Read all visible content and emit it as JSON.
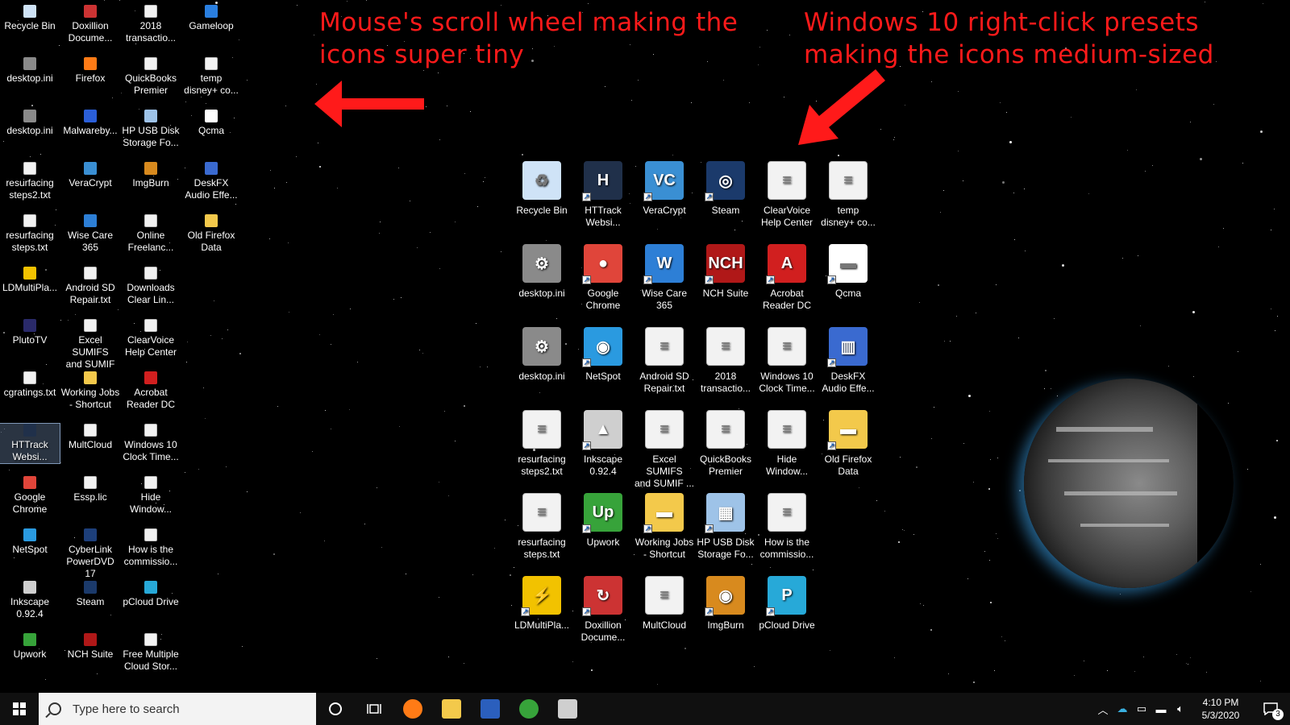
{
  "annotations": {
    "left": [
      "Mouse's scroll wheel making the",
      "icons super tiny"
    ],
    "right": [
      "Windows 10 right-click presets",
      "making the icons medium-sized"
    ],
    "color": "#ff1a1a"
  },
  "small_icons": [
    {
      "label": [
        "Recycle Bin"
      ],
      "icon": "recycle-bin-icon",
      "color": "#cfe3f7"
    },
    {
      "label": [
        "desktop.ini"
      ],
      "icon": "settings-file-icon",
      "color": "#8a8a8a"
    },
    {
      "label": [
        "desktop.ini"
      ],
      "icon": "settings-file-icon",
      "color": "#8a8a8a"
    },
    {
      "label": [
        "resurfacing",
        "steps2.txt"
      ],
      "icon": "text-file-icon",
      "color": "#f2f2f2"
    },
    {
      "label": [
        "resurfacing",
        "steps.txt"
      ],
      "icon": "text-file-icon",
      "color": "#f2f2f2"
    },
    {
      "label": [
        "LDMultiPla..."
      ],
      "icon": "ldmultiplayer-icon",
      "color": "#f2c200"
    },
    {
      "label": [
        "PlutoTV"
      ],
      "icon": "plutotv-icon",
      "color": "#2a2a6a"
    },
    {
      "label": [
        "cgratings.txt"
      ],
      "icon": "text-file-icon",
      "color": "#f2f2f2"
    },
    {
      "label": [
        "HTTrack",
        "Websi..."
      ],
      "icon": "httrack-icon",
      "color": "#20304a",
      "selected": true
    },
    {
      "label": [
        "Google",
        "Chrome"
      ],
      "icon": "chrome-icon",
      "color": "#e0453a"
    },
    {
      "label": [
        "NetSpot"
      ],
      "icon": "netspot-icon",
      "color": "#2a9ae0"
    },
    {
      "label": [
        "Inkscape",
        "0.92.4"
      ],
      "icon": "inkscape-icon",
      "color": "#cfcfcf"
    },
    {
      "label": [
        "Upwork"
      ],
      "icon": "upwork-icon",
      "color": "#37a33a"
    },
    {
      "label": [
        "Doxillion",
        "Docume..."
      ],
      "icon": "doxillion-icon",
      "color": "#c33"
    },
    {
      "label": [
        "Firefox"
      ],
      "icon": "firefox-icon",
      "color": "#ff7b16"
    },
    {
      "label": [
        "Malwareby..."
      ],
      "icon": "malwarebytes-icon",
      "color": "#2b5fd9"
    },
    {
      "label": [
        "VeraCrypt"
      ],
      "icon": "veracrypt-icon",
      "color": "#3a8fd3"
    },
    {
      "label": [
        "Wise Care",
        "365"
      ],
      "icon": "wisecare-icon",
      "color": "#2d7fd6"
    },
    {
      "label": [
        "Android SD",
        "Repair.txt"
      ],
      "icon": "text-file-icon",
      "color": "#f2f2f2"
    },
    {
      "label": [
        "Excel SUMIFS",
        "and SUMIF ..."
      ],
      "icon": "text-file-icon",
      "color": "#f2f2f2"
    },
    {
      "label": [
        "Working Jobs",
        "- Shortcut"
      ],
      "icon": "folder-icon",
      "color": "#f3c94b"
    },
    {
      "label": [
        "MultCloud"
      ],
      "icon": "text-file-icon",
      "color": "#f2f2f2"
    },
    {
      "label": [
        "Essp.lic"
      ],
      "icon": "text-file-icon",
      "color": "#f2f2f2"
    },
    {
      "label": [
        "CyberLink",
        "PowerDVD 17"
      ],
      "icon": "powerdvd-icon",
      "color": "#1d3f7a"
    },
    {
      "label": [
        "Steam"
      ],
      "icon": "steam-icon",
      "color": "#1b3a6b"
    },
    {
      "label": [
        "NCH Suite"
      ],
      "icon": "nch-icon",
      "color": "#b01818"
    },
    {
      "label": [
        "2018",
        "transactio..."
      ],
      "icon": "text-file-icon",
      "color": "#f2f2f2"
    },
    {
      "label": [
        "QuickBooks",
        "Premier"
      ],
      "icon": "text-file-icon",
      "color": "#f2f2f2"
    },
    {
      "label": [
        "HP USB Disk",
        "Storage Fo..."
      ],
      "icon": "hp-usb-icon",
      "color": "#9ec3e8"
    },
    {
      "label": [
        "ImgBurn"
      ],
      "icon": "imgburn-icon",
      "color": "#d88a1e"
    },
    {
      "label": [
        "Online",
        "Freelanc..."
      ],
      "icon": "text-file-icon",
      "color": "#f2f2f2"
    },
    {
      "label": [
        "Downloads",
        "Clear Lin..."
      ],
      "icon": "text-file-icon",
      "color": "#f2f2f2"
    },
    {
      "label": [
        "ClearVoice",
        "Help Center"
      ],
      "icon": "text-file-icon",
      "color": "#f2f2f2"
    },
    {
      "label": [
        "Acrobat",
        "Reader DC"
      ],
      "icon": "acrobat-icon",
      "color": "#d11f1f"
    },
    {
      "label": [
        "Windows 10",
        "Clock Time..."
      ],
      "icon": "text-file-icon",
      "color": "#f2f2f2"
    },
    {
      "label": [
        "Hide",
        "Window..."
      ],
      "icon": "text-file-icon",
      "color": "#f2f2f2"
    },
    {
      "label": [
        "How is the",
        "commissio..."
      ],
      "icon": "text-file-icon",
      "color": "#f2f2f2"
    },
    {
      "label": [
        "pCloud Drive"
      ],
      "icon": "pcloud-icon",
      "color": "#27a9d8"
    },
    {
      "label": [
        "Free Multiple",
        "Cloud Stor..."
      ],
      "icon": "text-file-icon",
      "color": "#f2f2f2"
    },
    {
      "label": [
        "Gameloop"
      ],
      "icon": "gameloop-icon",
      "color": "#2a7fe0"
    },
    {
      "label": [
        "temp",
        "disney+ co..."
      ],
      "icon": "text-file-icon",
      "color": "#f2f2f2"
    },
    {
      "label": [
        "Qcma"
      ],
      "icon": "qcma-icon",
      "color": "#ffffff"
    },
    {
      "label": [
        "DeskFX",
        "Audio Effe..."
      ],
      "icon": "deskfx-icon",
      "color": "#3a6ad0"
    },
    {
      "label": [
        "Old Firefox",
        "Data"
      ],
      "icon": "folder-icon",
      "color": "#f3c94b"
    }
  ],
  "medium_icons": [
    {
      "label": [
        "Recycle Bin"
      ],
      "icon": "recycle-bin-icon",
      "color": "#cfe3f7",
      "glyph": "♻"
    },
    {
      "label": [
        "desktop.ini"
      ],
      "icon": "settings-file-icon",
      "color": "#8a8a8a",
      "glyph": "⚙"
    },
    {
      "label": [
        "desktop.ini"
      ],
      "icon": "settings-file-icon",
      "color": "#8a8a8a",
      "glyph": "⚙"
    },
    {
      "label": [
        "resurfacing",
        "steps2.txt"
      ],
      "icon": "text-file-icon",
      "color": "#f2f2f2",
      "glyph": "≡"
    },
    {
      "label": [
        "resurfacing",
        "steps.txt"
      ],
      "icon": "text-file-icon",
      "color": "#f2f2f2",
      "glyph": "≡"
    },
    {
      "label": [
        "LDMultiPla..."
      ],
      "icon": "ldmultiplayer-icon",
      "color": "#f2c200",
      "glyph": "⚡"
    },
    {
      "label": [
        "HTTrack",
        "Websi..."
      ],
      "icon": "httrack-icon",
      "color": "#20304a",
      "glyph": "H"
    },
    {
      "label": [
        "Google",
        "Chrome"
      ],
      "icon": "chrome-icon",
      "color": "#e0453a",
      "glyph": "●"
    },
    {
      "label": [
        "NetSpot"
      ],
      "icon": "netspot-icon",
      "color": "#2a9ae0",
      "glyph": "◉"
    },
    {
      "label": [
        "Inkscape",
        "0.92.4"
      ],
      "icon": "inkscape-icon",
      "color": "#cfcfcf",
      "glyph": "▲"
    },
    {
      "label": [
        "Upwork"
      ],
      "icon": "upwork-icon",
      "color": "#37a33a",
      "glyph": "Up"
    },
    {
      "label": [
        "Doxillion",
        "Docume..."
      ],
      "icon": "doxillion-icon",
      "color": "#c33",
      "glyph": "↻"
    },
    {
      "label": [
        "VeraCrypt"
      ],
      "icon": "veracrypt-icon",
      "color": "#3a8fd3",
      "glyph": "VC"
    },
    {
      "label": [
        "Wise Care",
        "365"
      ],
      "icon": "wisecare-icon",
      "color": "#2d7fd6",
      "glyph": "W"
    },
    {
      "label": [
        "Android SD",
        "Repair.txt"
      ],
      "icon": "text-file-icon",
      "color": "#f2f2f2",
      "glyph": "≡"
    },
    {
      "label": [
        "Excel SUMIFS",
        "and SUMIF ..."
      ],
      "icon": "text-file-icon",
      "color": "#f2f2f2",
      "glyph": "≡"
    },
    {
      "label": [
        "Working Jobs",
        "- Shortcut"
      ],
      "icon": "folder-icon",
      "color": "#f3c94b",
      "glyph": "▬"
    },
    {
      "label": [
        "MultCloud"
      ],
      "icon": "text-file-icon",
      "color": "#f2f2f2",
      "glyph": "≡"
    },
    {
      "label": [
        "Steam"
      ],
      "icon": "steam-icon",
      "color": "#1b3a6b",
      "glyph": "◎"
    },
    {
      "label": [
        "NCH Suite"
      ],
      "icon": "nch-icon",
      "color": "#b01818",
      "glyph": "NCH"
    },
    {
      "label": [
        "2018",
        "transactio..."
      ],
      "icon": "text-file-icon",
      "color": "#f2f2f2",
      "glyph": "≡"
    },
    {
      "label": [
        "QuickBooks",
        "Premier"
      ],
      "icon": "text-file-icon",
      "color": "#f2f2f2",
      "glyph": "≡"
    },
    {
      "label": [
        "HP USB Disk",
        "Storage Fo..."
      ],
      "icon": "hp-usb-icon",
      "color": "#9ec3e8",
      "glyph": "▦"
    },
    {
      "label": [
        "ImgBurn"
      ],
      "icon": "imgburn-icon",
      "color": "#d88a1e",
      "glyph": "◉"
    },
    {
      "label": [
        "ClearVoice",
        "Help Center"
      ],
      "icon": "text-file-icon",
      "color": "#f2f2f2",
      "glyph": "≡"
    },
    {
      "label": [
        "Acrobat",
        "Reader DC"
      ],
      "icon": "acrobat-icon",
      "color": "#d11f1f",
      "glyph": "A"
    },
    {
      "label": [
        "Windows 10",
        "Clock Time..."
      ],
      "icon": "text-file-icon",
      "color": "#f2f2f2",
      "glyph": "≡"
    },
    {
      "label": [
        "Hide",
        "Window..."
      ],
      "icon": "text-file-icon",
      "color": "#f2f2f2",
      "glyph": "≡"
    },
    {
      "label": [
        "How is the",
        "commissio..."
      ],
      "icon": "text-file-icon",
      "color": "#f2f2f2",
      "glyph": "≡"
    },
    {
      "label": [
        "pCloud Drive"
      ],
      "icon": "pcloud-icon",
      "color": "#27a9d8",
      "glyph": "P"
    },
    {
      "label": [
        "temp",
        "disney+ co..."
      ],
      "icon": "text-file-icon",
      "color": "#f2f2f2",
      "glyph": "≡"
    },
    {
      "label": [
        "Qcma"
      ],
      "icon": "qcma-icon",
      "color": "#ffffff",
      "glyph": "▬"
    },
    {
      "label": [
        "DeskFX",
        "Audio Effe..."
      ],
      "icon": "deskfx-icon",
      "color": "#3a6ad0",
      "glyph": "▥"
    },
    {
      "label": [
        "Old Firefox",
        "Data"
      ],
      "icon": "folder-icon",
      "color": "#f3c94b",
      "glyph": "▬"
    }
  ],
  "taskbar": {
    "search_placeholder": "Type here to search",
    "pinned": [
      {
        "name": "firefox-icon",
        "color": "#ff7b16"
      },
      {
        "name": "file-explorer-icon",
        "color": "#f3c94b"
      },
      {
        "name": "word-icon",
        "color": "#2b5fbd"
      },
      {
        "name": "upwork-icon",
        "color": "#37a33a"
      },
      {
        "name": "inkscape-icon",
        "color": "#cfcfcf"
      }
    ],
    "time": "4:10 PM",
    "date": "5/3/2020",
    "notification_count": "3"
  }
}
